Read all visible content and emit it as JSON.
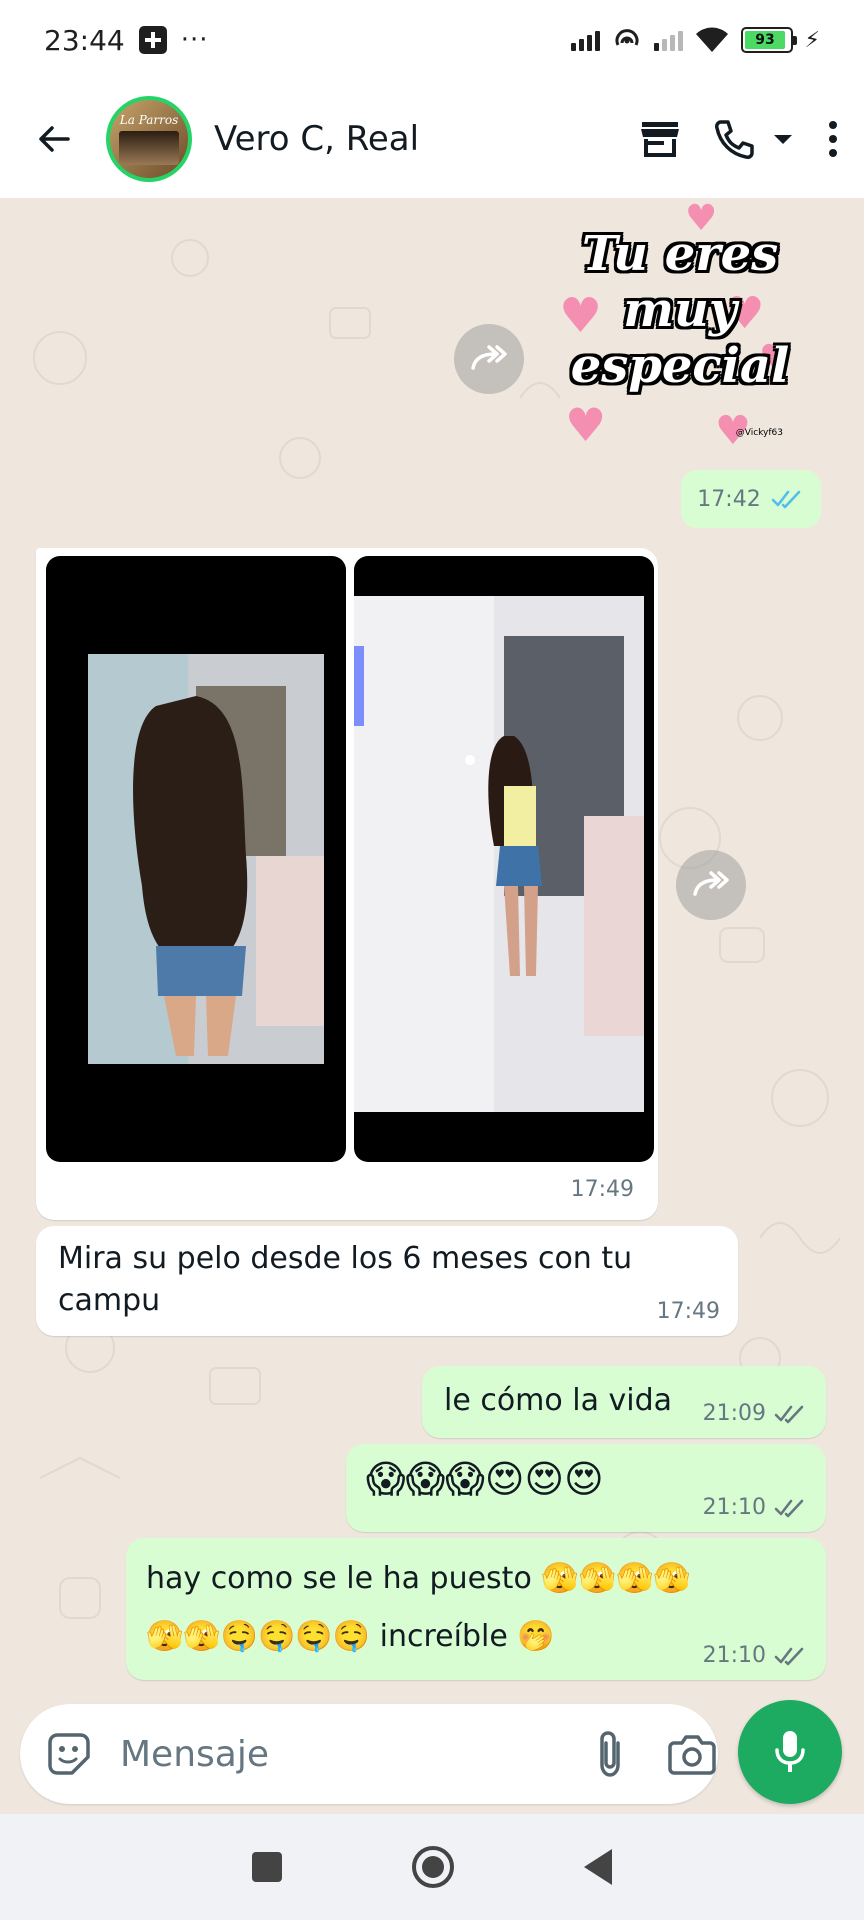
{
  "status_bar": {
    "time": "23:44",
    "battery": "93",
    "icons": [
      "plus-box-icon",
      "more-dots-icon",
      "signal-icon",
      "hotspot-icon",
      "signal-icon",
      "wifi-icon",
      "battery-icon",
      "charging-icon"
    ]
  },
  "header": {
    "contact_name": "Vero C, Real",
    "avatar_logo": "La Parros",
    "icons": [
      "back-arrow-icon",
      "store-icon",
      "phone-icon",
      "chevron-down-icon",
      "more-vert-icon"
    ]
  },
  "messages": {
    "sticker": {
      "text_line1": "Tu eres",
      "text_line2": "muy",
      "text_line3": "especial",
      "credit": "@Vickyf63",
      "time": "17:42",
      "status": "read"
    },
    "photos": {
      "time": "17:49"
    },
    "incoming_text": {
      "text": "Mira su pelo desde los 6 meses con tu campu",
      "time": "17:49"
    },
    "out1": {
      "text": "le cómo la vida",
      "time": "21:09",
      "status": "delivered"
    },
    "out2": {
      "text": "😱😱😱😍😍😍",
      "time": "21:10",
      "status": "delivered"
    },
    "out3": {
      "line1": "hay como se le ha puesto 🫣🫣🫣🫣",
      "line2": "🫣🫣🤤🤤🤤🤤 increíble 🤭",
      "time": "21:10",
      "status": "delivered"
    }
  },
  "input": {
    "placeholder": "Mensaje"
  },
  "colors": {
    "outgoing_bubble": "#d9fdd3",
    "incoming_bubble": "#ffffff",
    "chat_background": "#efe7de",
    "accent_green": "#1daa61",
    "read_tick_blue": "#53bdeb"
  }
}
